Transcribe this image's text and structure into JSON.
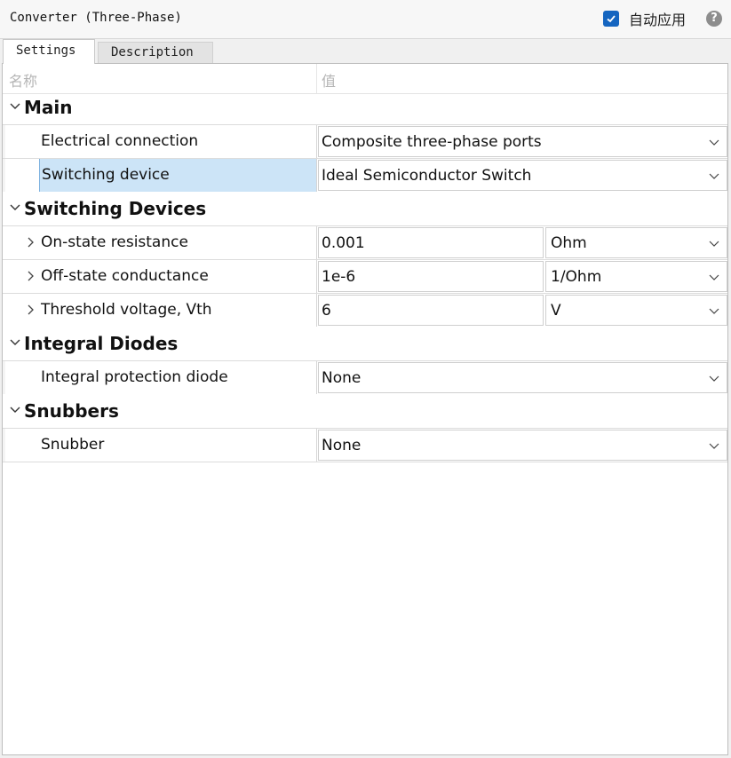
{
  "window": {
    "title": "Converter (Three-Phase)",
    "auto_apply_label": "自动应用",
    "auto_apply_checked": true,
    "help_glyph": "?"
  },
  "tabs": [
    {
      "label": "Settings",
      "active": true
    },
    {
      "label": "Description",
      "active": false
    }
  ],
  "columns": {
    "name": "名称",
    "value": "值"
  },
  "groups": [
    {
      "label": "Main"
    },
    {
      "label": "Switching Devices"
    },
    {
      "label": "Integral Diodes"
    },
    {
      "label": "Snubbers"
    }
  ],
  "params": {
    "electrical_connection": {
      "name": "Electrical connection",
      "value": "Composite three-phase ports"
    },
    "switching_device": {
      "name": "Switching device",
      "value": "Ideal Semiconductor Switch"
    },
    "on_state_resistance": {
      "name": "On-state resistance",
      "value": "0.001",
      "unit": "Ohm"
    },
    "off_state_conductance": {
      "name": "Off-state conductance",
      "value": "1e-6",
      "unit": "1/Ohm"
    },
    "threshold_voltage": {
      "name": "Threshold voltage, Vth",
      "value": "6",
      "unit": "V"
    },
    "integral_protection_diode": {
      "name": "Integral protection diode",
      "value": "None"
    },
    "snubber": {
      "name": "Snubber",
      "value": "None"
    }
  },
  "colors": {
    "accent": "#1565c0",
    "selection": "#cce4f7"
  }
}
